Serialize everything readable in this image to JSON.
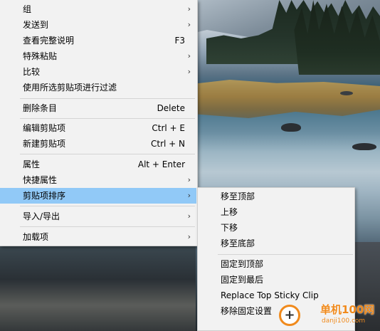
{
  "context_menu": {
    "items": [
      {
        "label": "组",
        "shortcut": "",
        "has_submenu": true
      },
      {
        "label": "发送到",
        "shortcut": "",
        "has_submenu": true
      },
      {
        "label": "查看完整说明",
        "shortcut": "F3",
        "has_submenu": false
      },
      {
        "label": "特殊粘贴",
        "shortcut": "",
        "has_submenu": true
      },
      {
        "label": "比较",
        "shortcut": "",
        "has_submenu": true
      },
      {
        "label": "使用所选剪贴项进行过滤",
        "shortcut": "",
        "has_submenu": false
      },
      {
        "label": "删除条目",
        "shortcut": "Delete",
        "has_submenu": false
      },
      {
        "label": "编辑剪贴项",
        "shortcut": "Ctrl + E",
        "has_submenu": false
      },
      {
        "label": "新建剪贴项",
        "shortcut": "Ctrl + N",
        "has_submenu": false
      },
      {
        "label": "属性",
        "shortcut": "Alt + Enter",
        "has_submenu": false
      },
      {
        "label": "快捷属性",
        "shortcut": "",
        "has_submenu": true
      },
      {
        "label": "剪贴项排序",
        "shortcut": "",
        "has_submenu": true,
        "highlighted": true
      },
      {
        "label": "导入/导出",
        "shortcut": "",
        "has_submenu": true
      },
      {
        "label": "加载项",
        "shortcut": "",
        "has_submenu": true
      }
    ],
    "submenu_arrow": "›"
  },
  "sort_submenu": {
    "items": [
      {
        "label": "移至顶部"
      },
      {
        "label": "上移"
      },
      {
        "label": "下移"
      },
      {
        "label": "移至底部"
      },
      {
        "label": "固定到顶部"
      },
      {
        "label": "固定到最后"
      },
      {
        "label": "Replace Top Sticky Clip"
      },
      {
        "label": "移除固定设置"
      }
    ]
  },
  "watermark": {
    "icon": "plus-circle-logo",
    "plus": "+",
    "text": "单机100网",
    "url": "danji100.com"
  },
  "colors": {
    "menu_background": "#f2f2f2",
    "highlight": "#91c9f7",
    "watermark_orange": "#f08a1c"
  }
}
